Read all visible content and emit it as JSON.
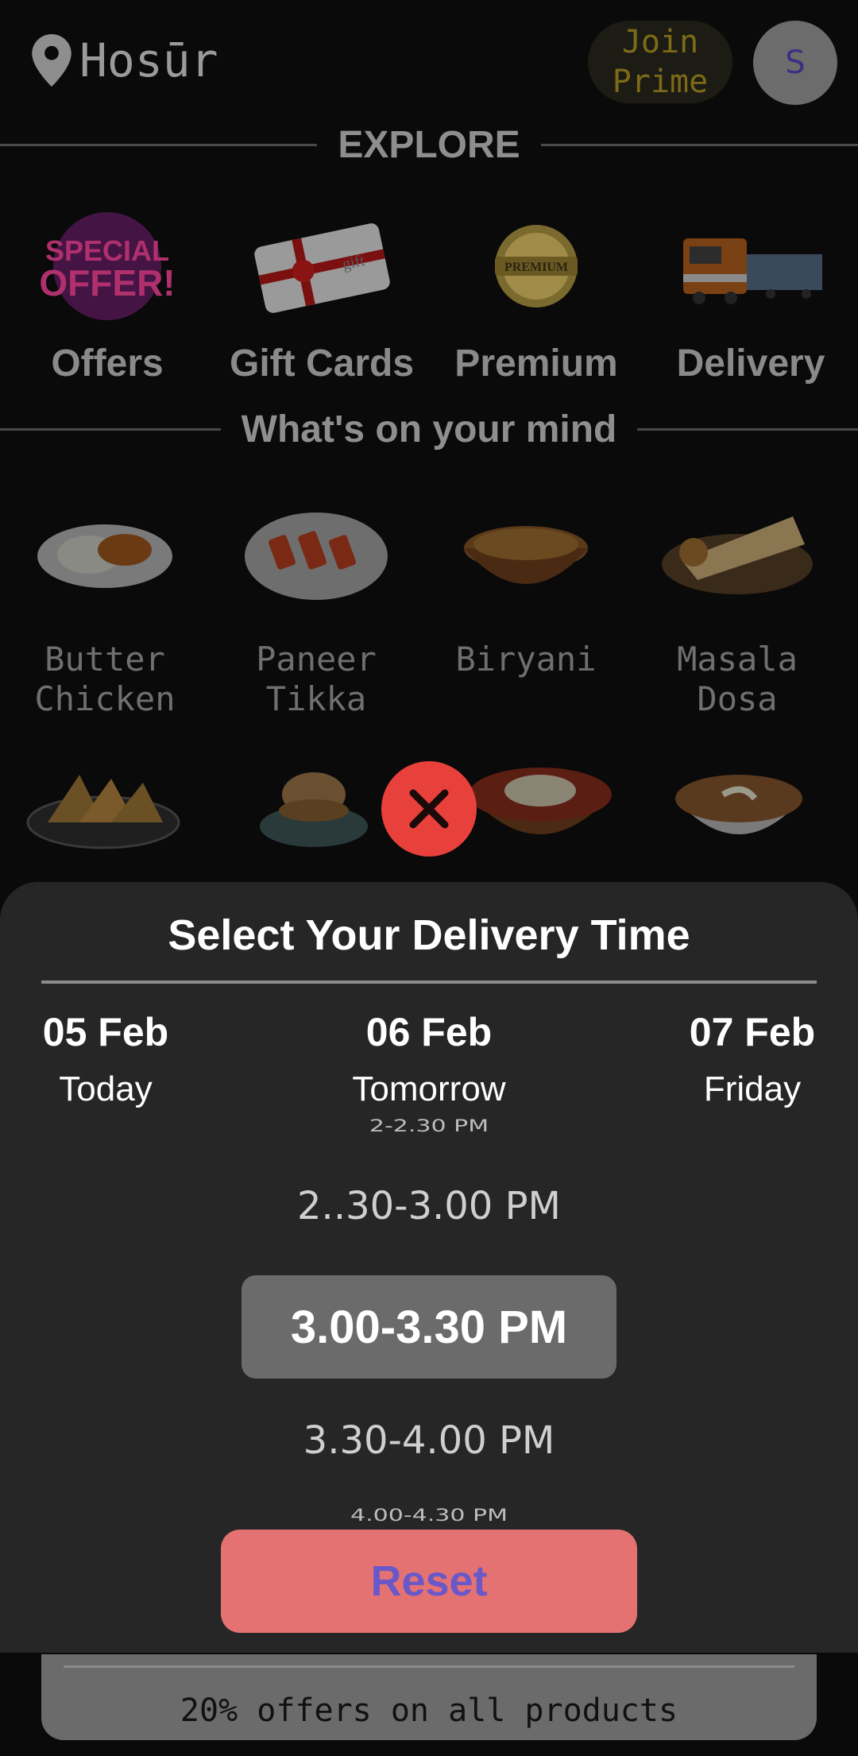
{
  "header": {
    "location": "Hosūr",
    "prime_line1": "Join",
    "prime_line2": "Prime",
    "avatar_initial": "S"
  },
  "explore": {
    "title": "EXPLORE",
    "items": [
      {
        "label": "Offers",
        "icon": "special-offer-badge",
        "badge_line1": "SPECIAL",
        "badge_line2": "OFFER!"
      },
      {
        "label": "Gift Cards",
        "icon": "gift-card",
        "card_text": "gift"
      },
      {
        "label": "Premium",
        "icon": "premium-medal",
        "badge_text": "PREMIUM"
      },
      {
        "label": "Delivery",
        "icon": "train"
      }
    ]
  },
  "mind": {
    "title": "What's on your mind",
    "items": [
      {
        "line1": "Butter",
        "line2": "Chicken"
      },
      {
        "line1": "Paneer",
        "line2": "Tikka"
      },
      {
        "line1": "Biryani",
        "line2": ""
      },
      {
        "line1": "Masala",
        "line2": "Dosa"
      }
    ],
    "second_row_icons": [
      "samosa",
      "vada-pav",
      "rajma-chawal",
      "dal-makhani"
    ]
  },
  "sheet": {
    "title": "Select Your Delivery Time",
    "dates": [
      {
        "date": "05 Feb",
        "day": "Today"
      },
      {
        "date": "06 Feb",
        "day": "Tomorrow"
      },
      {
        "date": "07 Feb",
        "day": "Friday"
      }
    ],
    "slots": {
      "s1": "2-2.30 PM",
      "s2": "2..30-3.00 PM",
      "selected": "3.00-3.30 PM",
      "s4": "3.30-4.00 PM",
      "s5": "4.00-4.30 PM"
    },
    "reset_label": "Reset"
  },
  "offer_text": "20% offers on all products",
  "colors": {
    "sheet_bg": "#262626",
    "close_button": "#e8403a",
    "reset_bg": "#e57272",
    "reset_text": "#6a58c9"
  }
}
